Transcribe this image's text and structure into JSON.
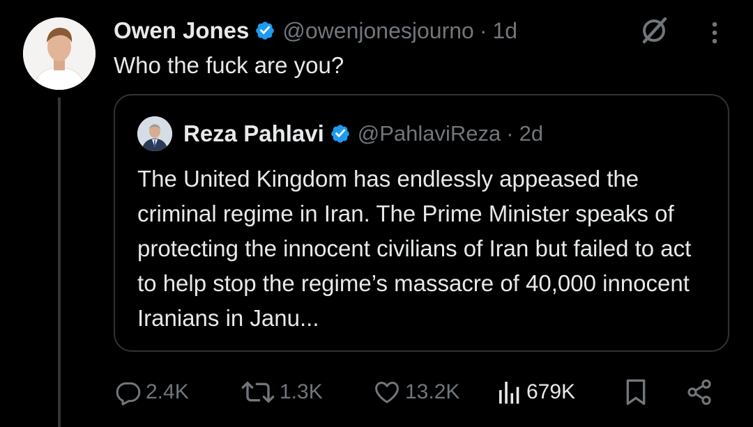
{
  "tweet": {
    "author_name": "Owen Jones",
    "handle": "@owenjonesjourno",
    "separator": "·",
    "time": "1d",
    "text": "Who the fuck are you?"
  },
  "quote": {
    "author_name": "Reza Pahlavi",
    "handle": "@PahlaviReza",
    "separator": "·",
    "time": "2d",
    "text": "The United Kingdom has endlessly appeased the criminal regime in Iran. The Prime Minister speaks of protecting the innocent civilians of Iran but failed to act to help stop the regime’s massacre of 40,000 innocent Iranians in Janu..."
  },
  "actions": {
    "replies": "2.4K",
    "reposts": "1.3K",
    "likes": "13.2K",
    "views": "679K"
  },
  "icons": {
    "verified": "verified-badge-icon",
    "grok": "grok-icon",
    "more": "more-options-icon",
    "reply": "reply-icon",
    "repost": "repost-icon",
    "like": "like-icon",
    "views": "views-icon",
    "bookmark": "bookmark-icon",
    "share": "share-icon"
  },
  "colors": {
    "background": "#000000",
    "text": "#e7e9ea",
    "secondary": "#71767b",
    "verified": "#1d9bf0",
    "border": "#2f3336"
  }
}
